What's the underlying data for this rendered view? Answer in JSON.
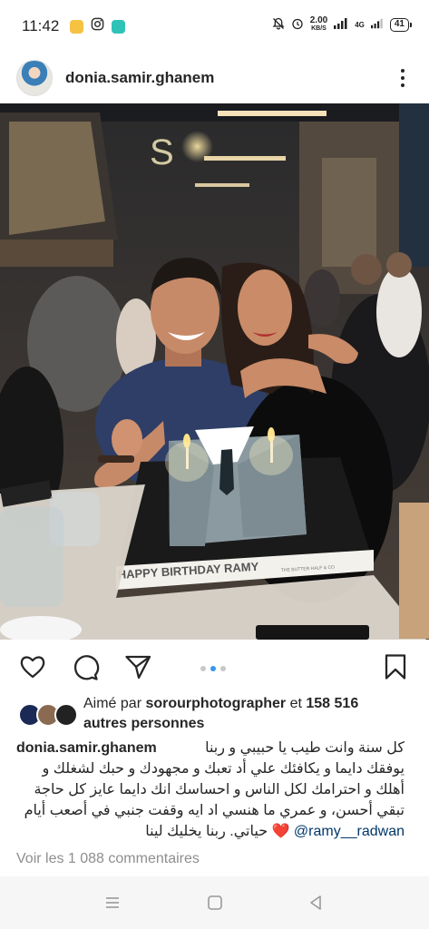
{
  "status_bar": {
    "time": "11:42",
    "network_speed": "2.00",
    "network_unit": "KB/S",
    "network_type": "4G",
    "battery": "41"
  },
  "post": {
    "username": "donia.samir.ghanem",
    "photo_text": {
      "cake_label": "HAPPY BIRTHDAY RAMY",
      "bakery": "THE BUTTER HALF & CO"
    }
  },
  "carousel": {
    "count": 3,
    "active_index": 1
  },
  "likes": {
    "prefix": "Aimé par ",
    "liker": "sorourphotographer",
    "middle": " et ",
    "count": "158 516",
    "suffix": "autres personnes"
  },
  "caption": {
    "username": "donia.samir.ghanem",
    "line1": "كل سنة وانت طيب يا حبيبي و ربنا",
    "line2": "يوفقك دايما و يكافئك علي أد تعبك و مجهودك و حبك لشغلك و",
    "line3": "أهلك و احترامك لكل الناس و احساسك انك دايما عايز كل حاجة",
    "line4": "تبقي أحسن، و عمري ما هنسي اد ايه وقفت جنبي في أصعب أيام",
    "line5_text": "حياتي. ربنا يخليك لينا",
    "heart": "❤️",
    "mention": "@ramy__radwan"
  },
  "comments_link": "Voir les 1 088 commentaires",
  "colors": {
    "link": "#00376b",
    "accent_dot": "#3897f0",
    "muted": "#8e8e8e",
    "text": "#262626"
  },
  "icons": [
    "like-heart-icon",
    "comment-icon",
    "share-icon",
    "save-bookmark-icon",
    "more-options-icon",
    "nav-menu-icon",
    "nav-home-icon",
    "nav-back-icon"
  ]
}
